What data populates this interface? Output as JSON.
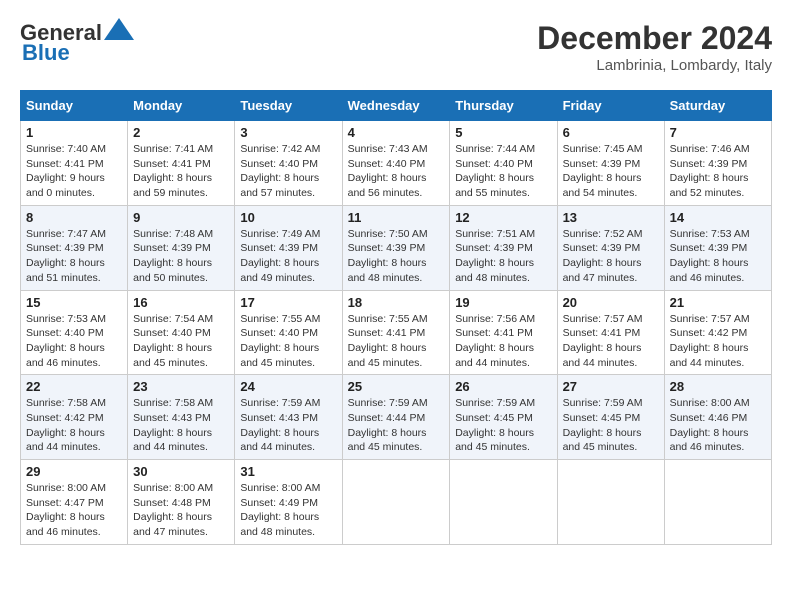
{
  "header": {
    "logo_line1": "General",
    "logo_line2": "Blue",
    "month_year": "December 2024",
    "location": "Lambrinia, Lombardy, Italy"
  },
  "weekdays": [
    "Sunday",
    "Monday",
    "Tuesday",
    "Wednesday",
    "Thursday",
    "Friday",
    "Saturday"
  ],
  "weeks": [
    [
      {
        "day": "1",
        "sunrise": "Sunrise: 7:40 AM",
        "sunset": "Sunset: 4:41 PM",
        "daylight": "Daylight: 9 hours and 0 minutes."
      },
      {
        "day": "2",
        "sunrise": "Sunrise: 7:41 AM",
        "sunset": "Sunset: 4:41 PM",
        "daylight": "Daylight: 8 hours and 59 minutes."
      },
      {
        "day": "3",
        "sunrise": "Sunrise: 7:42 AM",
        "sunset": "Sunset: 4:40 PM",
        "daylight": "Daylight: 8 hours and 57 minutes."
      },
      {
        "day": "4",
        "sunrise": "Sunrise: 7:43 AM",
        "sunset": "Sunset: 4:40 PM",
        "daylight": "Daylight: 8 hours and 56 minutes."
      },
      {
        "day": "5",
        "sunrise": "Sunrise: 7:44 AM",
        "sunset": "Sunset: 4:40 PM",
        "daylight": "Daylight: 8 hours and 55 minutes."
      },
      {
        "day": "6",
        "sunrise": "Sunrise: 7:45 AM",
        "sunset": "Sunset: 4:39 PM",
        "daylight": "Daylight: 8 hours and 54 minutes."
      },
      {
        "day": "7",
        "sunrise": "Sunrise: 7:46 AM",
        "sunset": "Sunset: 4:39 PM",
        "daylight": "Daylight: 8 hours and 52 minutes."
      }
    ],
    [
      {
        "day": "8",
        "sunrise": "Sunrise: 7:47 AM",
        "sunset": "Sunset: 4:39 PM",
        "daylight": "Daylight: 8 hours and 51 minutes."
      },
      {
        "day": "9",
        "sunrise": "Sunrise: 7:48 AM",
        "sunset": "Sunset: 4:39 PM",
        "daylight": "Daylight: 8 hours and 50 minutes."
      },
      {
        "day": "10",
        "sunrise": "Sunrise: 7:49 AM",
        "sunset": "Sunset: 4:39 PM",
        "daylight": "Daylight: 8 hours and 49 minutes."
      },
      {
        "day": "11",
        "sunrise": "Sunrise: 7:50 AM",
        "sunset": "Sunset: 4:39 PM",
        "daylight": "Daylight: 8 hours and 48 minutes."
      },
      {
        "day": "12",
        "sunrise": "Sunrise: 7:51 AM",
        "sunset": "Sunset: 4:39 PM",
        "daylight": "Daylight: 8 hours and 48 minutes."
      },
      {
        "day": "13",
        "sunrise": "Sunrise: 7:52 AM",
        "sunset": "Sunset: 4:39 PM",
        "daylight": "Daylight: 8 hours and 47 minutes."
      },
      {
        "day": "14",
        "sunrise": "Sunrise: 7:53 AM",
        "sunset": "Sunset: 4:39 PM",
        "daylight": "Daylight: 8 hours and 46 minutes."
      }
    ],
    [
      {
        "day": "15",
        "sunrise": "Sunrise: 7:53 AM",
        "sunset": "Sunset: 4:40 PM",
        "daylight": "Daylight: 8 hours and 46 minutes."
      },
      {
        "day": "16",
        "sunrise": "Sunrise: 7:54 AM",
        "sunset": "Sunset: 4:40 PM",
        "daylight": "Daylight: 8 hours and 45 minutes."
      },
      {
        "day": "17",
        "sunrise": "Sunrise: 7:55 AM",
        "sunset": "Sunset: 4:40 PM",
        "daylight": "Daylight: 8 hours and 45 minutes."
      },
      {
        "day": "18",
        "sunrise": "Sunrise: 7:55 AM",
        "sunset": "Sunset: 4:41 PM",
        "daylight": "Daylight: 8 hours and 45 minutes."
      },
      {
        "day": "19",
        "sunrise": "Sunrise: 7:56 AM",
        "sunset": "Sunset: 4:41 PM",
        "daylight": "Daylight: 8 hours and 44 minutes."
      },
      {
        "day": "20",
        "sunrise": "Sunrise: 7:57 AM",
        "sunset": "Sunset: 4:41 PM",
        "daylight": "Daylight: 8 hours and 44 minutes."
      },
      {
        "day": "21",
        "sunrise": "Sunrise: 7:57 AM",
        "sunset": "Sunset: 4:42 PM",
        "daylight": "Daylight: 8 hours and 44 minutes."
      }
    ],
    [
      {
        "day": "22",
        "sunrise": "Sunrise: 7:58 AM",
        "sunset": "Sunset: 4:42 PM",
        "daylight": "Daylight: 8 hours and 44 minutes."
      },
      {
        "day": "23",
        "sunrise": "Sunrise: 7:58 AM",
        "sunset": "Sunset: 4:43 PM",
        "daylight": "Daylight: 8 hours and 44 minutes."
      },
      {
        "day": "24",
        "sunrise": "Sunrise: 7:59 AM",
        "sunset": "Sunset: 4:43 PM",
        "daylight": "Daylight: 8 hours and 44 minutes."
      },
      {
        "day": "25",
        "sunrise": "Sunrise: 7:59 AM",
        "sunset": "Sunset: 4:44 PM",
        "daylight": "Daylight: 8 hours and 45 minutes."
      },
      {
        "day": "26",
        "sunrise": "Sunrise: 7:59 AM",
        "sunset": "Sunset: 4:45 PM",
        "daylight": "Daylight: 8 hours and 45 minutes."
      },
      {
        "day": "27",
        "sunrise": "Sunrise: 7:59 AM",
        "sunset": "Sunset: 4:45 PM",
        "daylight": "Daylight: 8 hours and 45 minutes."
      },
      {
        "day": "28",
        "sunrise": "Sunrise: 8:00 AM",
        "sunset": "Sunset: 4:46 PM",
        "daylight": "Daylight: 8 hours and 46 minutes."
      }
    ],
    [
      {
        "day": "29",
        "sunrise": "Sunrise: 8:00 AM",
        "sunset": "Sunset: 4:47 PM",
        "daylight": "Daylight: 8 hours and 46 minutes."
      },
      {
        "day": "30",
        "sunrise": "Sunrise: 8:00 AM",
        "sunset": "Sunset: 4:48 PM",
        "daylight": "Daylight: 8 hours and 47 minutes."
      },
      {
        "day": "31",
        "sunrise": "Sunrise: 8:00 AM",
        "sunset": "Sunset: 4:49 PM",
        "daylight": "Daylight: 8 hours and 48 minutes."
      },
      null,
      null,
      null,
      null
    ]
  ]
}
